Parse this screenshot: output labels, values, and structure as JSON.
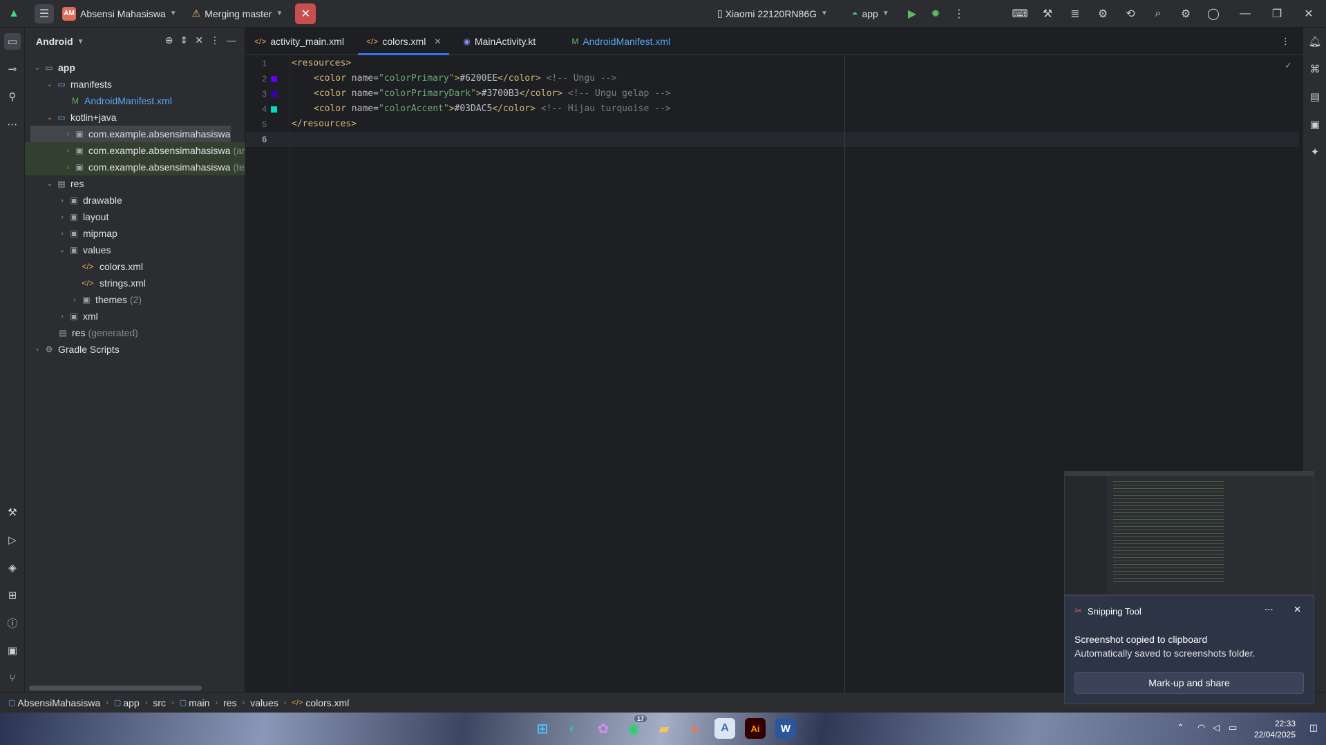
{
  "titlebar": {
    "project_badge": "AM",
    "project_name": "Absensi Mahasiswa",
    "branch": "Merging master",
    "device": "Xiaomi 22120RN86G",
    "run_config": "app"
  },
  "project_panel": {
    "view_mode": "Android",
    "tree": [
      {
        "label": "app",
        "suffix": ""
      },
      {
        "label": "manifests",
        "suffix": ""
      },
      {
        "label": "AndroidManifest.xml",
        "suffix": ""
      },
      {
        "label": "kotlin+java",
        "suffix": ""
      },
      {
        "label": "com.example.absensimahasiswa",
        "suffix": ""
      },
      {
        "label": "com.example.absensimahasiswa",
        "suffix": "(ar"
      },
      {
        "label": "com.example.absensimahasiswa",
        "suffix": "(te"
      },
      {
        "label": "res",
        "suffix": ""
      },
      {
        "label": "drawable",
        "suffix": ""
      },
      {
        "label": "layout",
        "suffix": ""
      },
      {
        "label": "mipmap",
        "suffix": ""
      },
      {
        "label": "values",
        "suffix": ""
      },
      {
        "label": "colors.xml",
        "suffix": ""
      },
      {
        "label": "strings.xml",
        "suffix": ""
      },
      {
        "label": "themes",
        "suffix": "(2)"
      },
      {
        "label": "xml",
        "suffix": ""
      },
      {
        "label": "res",
        "suffix": "(generated)"
      },
      {
        "label": "Gradle Scripts",
        "suffix": ""
      }
    ]
  },
  "tabs": [
    {
      "label": "activity_main.xml"
    },
    {
      "label": "colors.xml"
    },
    {
      "label": "MainActivity.kt"
    },
    {
      "label": "AndroidManifest.xml"
    }
  ],
  "editor": {
    "line_numbers": [
      "1",
      "2",
      "3",
      "4",
      "5",
      "6"
    ],
    "swatch_colors": [
      "#6200EE",
      "#3700B3",
      "#03DAC5"
    ],
    "lines": [
      {
        "open": "<resources>"
      },
      {
        "tag_open": "<color",
        "attr": " name=",
        "val": "\"colorPrimary\"",
        "close": ">",
        "text": "#6200EE",
        "tag_close": "</color>",
        "comment": " <!-- Ungu -->"
      },
      {
        "tag_open": "<color",
        "attr": " name=",
        "val": "\"colorPrimaryDark\"",
        "close": ">",
        "text": "#3700B3",
        "tag_close": "</color>",
        "comment": " <!-- Ungu gelap -->"
      },
      {
        "tag_open": "<color",
        "attr": " name=",
        "val": "\"colorAccent\"",
        "close": ">",
        "text": "#03DAC5",
        "tag_close": "</color>",
        "comment": " <!-- Hijau turquoise -->"
      },
      {
        "close_tag": "</resources>"
      }
    ]
  },
  "breadcrumb": [
    "AbsensiMahasiswa",
    "app",
    "src",
    "main",
    "res",
    "values",
    "colors.xml"
  ],
  "toast": {
    "app": "Snipping Tool",
    "title": "Screenshot copied to clipboard",
    "body": "Automatically saved to screenshots folder.",
    "button": "Mark-up and share"
  },
  "taskbar": {
    "whatsapp_badge": "17",
    "time": "22:33",
    "date": "22/04/2025"
  },
  "colors": {
    "accent": "#3574f0",
    "close_button": "#c94f4f"
  }
}
